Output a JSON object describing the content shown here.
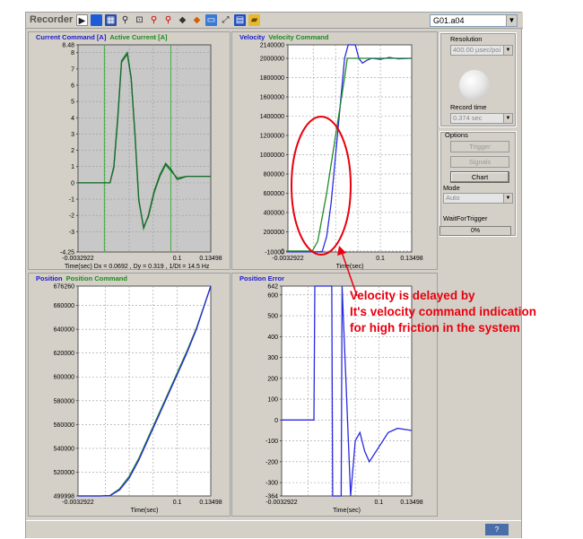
{
  "toolbar": {
    "title": "Recorder",
    "file_value": "G01.a04",
    "icons": [
      "play-icon",
      "stop-icon",
      "save-icon",
      "zoom-icon",
      "zoom-fit-icon",
      "zoom-in-icon",
      "zoom-out-icon",
      "cursor-left-icon",
      "cursor-right-icon",
      "window-icon",
      "fit-icon",
      "disk-icon",
      "open-icon"
    ]
  },
  "panels": [
    {
      "id": "current",
      "title1": "Current Command [A]",
      "title2": "Active Current [A]",
      "yticks": [
        "8.48",
        "8",
        "7",
        "6",
        "5",
        "4",
        "3",
        "2",
        "1",
        "0",
        "-1",
        "-2",
        "-3",
        "-4.25"
      ],
      "xticks": [
        "-0.0032922",
        "0.1",
        "0.13498"
      ],
      "xlabel": "Time(sec)",
      "readout": "Time(sec) Dx = 0.0692 , Dy = 0.319 , 1/Dt = 14.5 Hz"
    },
    {
      "id": "velocity",
      "title1": "Velocity",
      "title2": "Velocity Command",
      "yticks": [
        "2140000",
        "2000000",
        "1800000",
        "1600000",
        "1400000",
        "1200000",
        "1000000",
        "800000",
        "600000",
        "400000",
        "200000",
        "0",
        "-10000"
      ],
      "xticks": [
        "-0.0032922",
        "0.1",
        "0.13498"
      ],
      "xlabel": "Time(sec)"
    },
    {
      "id": "position",
      "title1": "Position",
      "title2": "Position Command",
      "yticks": [
        "676260",
        "660000",
        "640000",
        "620000",
        "600000",
        "580000",
        "560000",
        "540000",
        "520000",
        "499998"
      ],
      "xticks": [
        "-0.0032922",
        "0.1",
        "0.13498"
      ],
      "xlabel": "Time(sec)"
    },
    {
      "id": "position_error",
      "title1": "Position Error",
      "title2": "",
      "yticks": [
        "642",
        "600",
        "500",
        "400",
        "300",
        "200",
        "100",
        "0",
        "-100",
        "-200",
        "-300",
        "-364"
      ],
      "xticks": [
        "-0.0032922",
        "0.1",
        "0.13498"
      ],
      "xlabel": "Time(sec)"
    }
  ],
  "side": {
    "resolution_label": "Resolution",
    "resolution_value": "400.00 µsec/poi",
    "record_time_label": "Record time",
    "record_time_value": "0.374 sec",
    "options_label": "Options",
    "trigger_label": "Trigger",
    "signals_label": "Signals",
    "chart_label": "Chart",
    "mode_label": "Mode",
    "mode_value": "Auto",
    "wait_label": "WaitForTrigger",
    "progress_text": "0%",
    "progress_value": 0
  },
  "status": {
    "help_label": "?"
  },
  "annotation": {
    "lines": [
      "Velocity is delayed by",
      "It's velocity command indication",
      "for high friction in the system"
    ]
  },
  "colors": {
    "command": "#1e8a28",
    "actual": "#2a2ae0",
    "annotation": "#e8000e",
    "grid": "#9a9a9a"
  },
  "chart_data": [
    {
      "type": "line",
      "title": "Current Command [A] / Active Current [A]",
      "xlabel": "Time(sec)",
      "ylabel": "",
      "xlim": [
        -0.0032922,
        0.13498
      ],
      "ylim": [
        -4.25,
        8.48
      ],
      "series": [
        {
          "name": "Current Command [A]",
          "x": [
            -0.0032922,
            0.02,
            0.03,
            0.034,
            0.038,
            0.042,
            0.048,
            0.052,
            0.056,
            0.06,
            0.065,
            0.07,
            0.076,
            0.082,
            0.088,
            0.094,
            0.1,
            0.11,
            0.12,
            0.13498
          ],
          "y": [
            0,
            0,
            0,
            1,
            4,
            7.5,
            8,
            6.5,
            3,
            -1,
            -2.8,
            -2,
            -0.5,
            0.5,
            1.2,
            0.8,
            0.2,
            0.4,
            0.4,
            0.4
          ]
        },
        {
          "name": "Active Current [A]",
          "x": [
            -0.0032922,
            0.02,
            0.03,
            0.034,
            0.038,
            0.042,
            0.048,
            0.052,
            0.056,
            0.06,
            0.065,
            0.07,
            0.076,
            0.082,
            0.088,
            0.094,
            0.1,
            0.11,
            0.12,
            0.13498
          ],
          "y": [
            0,
            0,
            0,
            0.9,
            3.8,
            7.4,
            7.9,
            6.4,
            2.9,
            -1.1,
            -2.7,
            -2.1,
            -0.6,
            0.4,
            1.1,
            0.7,
            0.3,
            0.4,
            0.4,
            0.4
          ]
        }
      ],
      "cursors_x": [
        0.0242,
        0.0934
      ],
      "grid": true
    },
    {
      "type": "line",
      "title": "Velocity / Velocity Command",
      "xlabel": "Time(sec)",
      "ylabel": "",
      "xlim": [
        -0.0032922,
        0.13498
      ],
      "ylim": [
        -10000,
        2140000
      ],
      "series": [
        {
          "name": "Velocity",
          "x": [
            -0.0032922,
            0.03,
            0.035,
            0.04,
            0.045,
            0.05,
            0.055,
            0.06,
            0.064,
            0.068,
            0.072,
            0.076,
            0.08,
            0.085,
            0.09,
            0.1,
            0.11,
            0.12,
            0.13498
          ],
          "y": [
            -8000,
            -8000,
            -5000,
            150000,
            500000,
            1000000,
            1500000,
            2000000,
            2250000,
            2300000,
            2150000,
            2000000,
            1950000,
            1980000,
            2000000,
            1990000,
            2010000,
            1995000,
            2000000
          ]
        },
        {
          "name": "Velocity Command",
          "x": [
            -0.0032922,
            0.024,
            0.03,
            0.04,
            0.05,
            0.06,
            0.063,
            0.07,
            0.08,
            0.1,
            0.13498
          ],
          "y": [
            0,
            0,
            100000,
            600000,
            1200000,
            1800000,
            2000000,
            2000000,
            2000000,
            2000000,
            2000000
          ]
        }
      ],
      "grid": true
    },
    {
      "type": "line",
      "title": "Position / Position Command",
      "xlabel": "Time(sec)",
      "ylabel": "",
      "xlim": [
        -0.0032922,
        0.13498
      ],
      "ylim": [
        499998,
        676260
      ],
      "series": [
        {
          "name": "Position",
          "x": [
            -0.0032922,
            0.02,
            0.03,
            0.04,
            0.05,
            0.06,
            0.07,
            0.08,
            0.09,
            0.1,
            0.11,
            0.12,
            0.13498
          ],
          "y": [
            499998,
            499998,
            500200,
            505000,
            515000,
            530000,
            548000,
            566000,
            584000,
            602000,
            620000,
            640000,
            676260
          ]
        },
        {
          "name": "Position Command",
          "x": [
            -0.0032922,
            0.02,
            0.03,
            0.04,
            0.05,
            0.06,
            0.07,
            0.08,
            0.09,
            0.1,
            0.11,
            0.12,
            0.13498
          ],
          "y": [
            499998,
            499998,
            500400,
            506000,
            516500,
            531500,
            549500,
            567500,
            585500,
            603500,
            621500,
            641000,
            676260
          ]
        }
      ],
      "grid": true
    },
    {
      "type": "line",
      "title": "Position Error",
      "xlabel": "Time(sec)",
      "ylabel": "",
      "xlim": [
        -0.0032922,
        0.13498
      ],
      "ylim": [
        -364,
        642
      ],
      "series": [
        {
          "name": "Position Error",
          "x": [
            -0.0032922,
            0.03,
            0.031,
            0.032,
            0.05,
            0.051,
            0.06,
            0.061,
            0.07,
            0.075,
            0.08,
            0.085,
            0.09,
            0.1,
            0.11,
            0.12,
            0.13498
          ],
          "y": [
            0,
            0,
            0,
            642,
            642,
            -364,
            -364,
            642,
            -364,
            -100,
            -60,
            -150,
            -200,
            -130,
            -60,
            -40,
            -50
          ]
        }
      ],
      "grid": true
    }
  ]
}
